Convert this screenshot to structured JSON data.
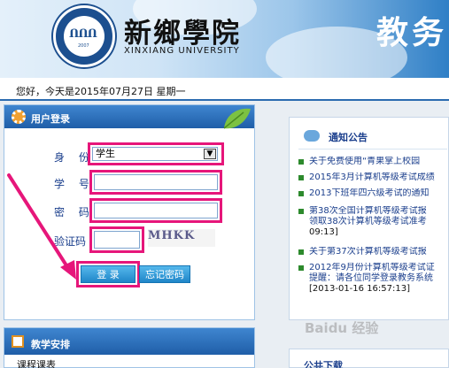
{
  "header": {
    "school_name_cn": "新鄉學院",
    "school_name_en": "XINXIANG UNIVERSITY",
    "title": "教务"
  },
  "greeting": "您好，今天是2015年07月27日 星期一",
  "login": {
    "title": "用户登录",
    "role_label": "身 份",
    "role_value": "学生",
    "id_label": "学 号",
    "id_value": "",
    "password_label": "密 码",
    "password_value": "",
    "captcha_label": "验证码",
    "captcha_value": "",
    "captcha_image_text": "MHKK",
    "login_button": "登 录",
    "forgot_button": "忘记密码"
  },
  "schedule": {
    "title": "教学安排",
    "items": [
      "课程课表"
    ]
  },
  "notices": {
    "title": "通知公告",
    "items": [
      {
        "text": "关于免费使用“青果掌上校园"
      },
      {
        "text": "2015年3月计算机等级考试成绩"
      },
      {
        "text": "2013下班年四六级考试的通知"
      },
      {
        "text": "第38次全国计算机等级考试报",
        "text2": "领取38次计算机等级考试准考",
        "date": "09:13]"
      },
      {
        "text": "关于第37次计算机等级考试报"
      },
      {
        "text": "2012年9月份计算机等级考试证",
        "text2": "提醒：请各位同学登录教务系统",
        "date": "[2013-01-16 16:57:13]"
      }
    ]
  },
  "downloads": {
    "title": "公共下载"
  },
  "watermark": "Baidu 经验",
  "colors": {
    "highlight": "#e6167a",
    "panel_header": "#2b6bb0",
    "link": "#1a3e8c"
  }
}
